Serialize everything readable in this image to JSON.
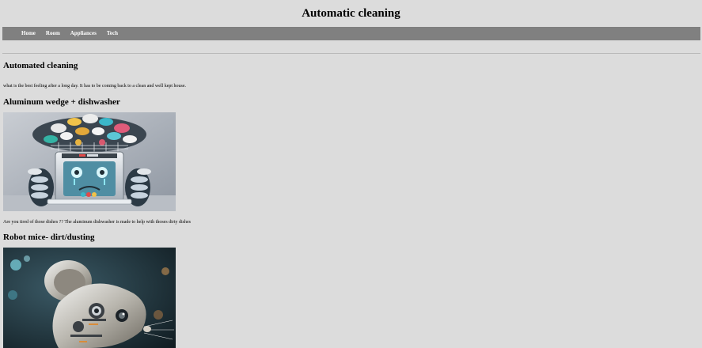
{
  "header": {
    "title": "Automatic cleaning"
  },
  "nav": {
    "items": [
      "Home",
      "Room",
      "Appliances",
      "Tech"
    ]
  },
  "main": {
    "intro_heading": "Automated cleaning",
    "intro_text": "what is the best feeling after a long day. It has to be coming back to a clean and well kept house.",
    "sections": [
      {
        "heading": "Aluminum wedge + dishwasher",
        "description": "Are you tired of those dishes ?? The aluminum dishwasher is made to help with thoses dirty dishes"
      },
      {
        "heading": "Robot mice- dirt/dusting"
      }
    ]
  },
  "colors": {
    "background": "#dcdcdc",
    "navbar": "#808080",
    "nav_text": "#ffffff"
  }
}
